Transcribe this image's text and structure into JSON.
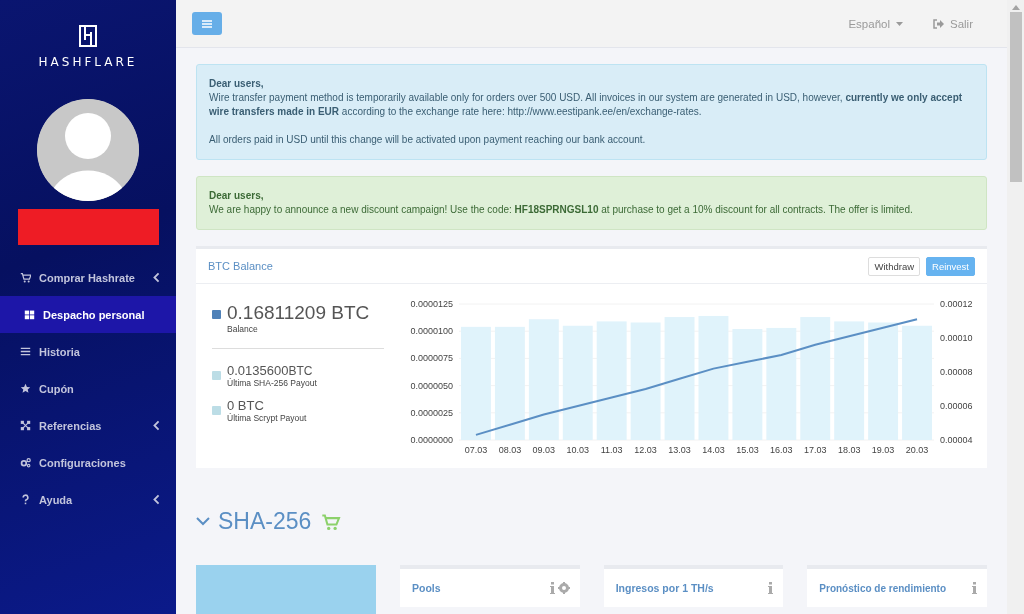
{
  "sidebar": {
    "logo_text": "HASHFLARE",
    "items": [
      {
        "kind": "cart",
        "label": "Comprar Hashrate",
        "has_submenu": true,
        "selected": false
      },
      {
        "kind": "grid",
        "label": "Despacho personal",
        "has_submenu": false,
        "selected": true
      },
      {
        "kind": "list",
        "label": "Historia",
        "has_submenu": false,
        "selected": false
      },
      {
        "kind": "star",
        "label": "Cupón",
        "has_submenu": false,
        "selected": false
      },
      {
        "kind": "network",
        "label": "Referencias",
        "has_submenu": true,
        "selected": false
      },
      {
        "kind": "gears",
        "label": "Configuraciones",
        "has_submenu": false,
        "selected": false
      },
      {
        "kind": "question",
        "label": "Ayuda",
        "has_submenu": true,
        "selected": false
      }
    ]
  },
  "topbar": {
    "language": "Español",
    "logout": "Salir"
  },
  "alerts": [
    {
      "kind": "info",
      "heading": "Dear users,",
      "text": "Wire transfer payment method is temporarily available only for orders over 500 USD. All invoices in our system are generated in USD, however, **currently we only accept wire transfers made in EUR** according to the exchange rate here:",
      "link": "http://www.eestipank.ee/en/exchange-rates",
      "text_after": ".",
      "note": "All orders paid in USD until this change will be activated upon payment reaching our bank account."
    },
    {
      "kind": "success",
      "heading": "Dear users,",
      "text": "We are happy to announce a new discount campaign! Use the code: **HF18SPRNGSL10** at purchase to get a 10% discount for all contracts. The offer is limited."
    }
  ],
  "balance_panel": {
    "title": "BTC Balance",
    "buttons": [
      {
        "label": "Withdraw",
        "kind": "default"
      },
      {
        "label": "Reinvest",
        "kind": "primary"
      }
    ],
    "stats": [
      {
        "value": "0.16811209 BTC",
        "label": "Balance",
        "color": "#4f81b8"
      },
      {
        "value": "0.0135600",
        "unit": "BTC",
        "label": "Última SHA-256 Payout",
        "color": "#bcdde6"
      },
      {
        "value": "0 BTC",
        "label": "Última Scrypt Payout",
        "color": "#bcdde6"
      }
    ],
    "chart_data": {
      "type": "bar",
      "categories": [
        "07.03",
        "08.03",
        "09.03",
        "10.03",
        "11.03",
        "12.03",
        "13.03",
        "14.03",
        "15.03",
        "16.03",
        "17.03",
        "18.03",
        "19.03",
        "20.03"
      ],
      "series": [
        {
          "color": "#e0f3fb",
          "values": [
            1.04e-05,
            1.04e-05,
            1.11e-05,
            1.05e-05,
            1.09e-05,
            1.08e-05,
            1.13e-05,
            1.14e-05,
            1.02e-05,
            1.03e-05,
            1.13e-05,
            1.09e-05,
            1.08e-05,
            1.05e-05
          ]
        },
        {
          "type": "line",
          "axis": "y2",
          "color": "#5b8fc4",
          "values": [
            4.3e-05,
            4.9e-05,
            5.5e-05,
            6e-05,
            6.5e-05,
            7e-05,
            7.6e-05,
            8.2e-05,
            8.6e-05,
            9e-05,
            9.6e-05,
            0.000101,
            0.000106,
            0.000111
          ]
        }
      ],
      "ylim": [
        0,
        1.25e-05
      ],
      "yticks": [
        {
          "value": 0,
          "label": "0.0000000"
        },
        {
          "value": 2.5e-06,
          "label": "0.0000025"
        },
        {
          "value": 5e-06,
          "label": "0.0000050"
        },
        {
          "value": 7.5e-06,
          "label": "0.0000075"
        },
        {
          "value": 1e-05,
          "label": "0.0000100"
        },
        {
          "value": 1.25e-05,
          "label": "0.0000125"
        }
      ],
      "grid": true,
      "y2lim": [
        4e-05,
        0.00012
      ],
      "y2ticks": [
        {
          "value": 4e-05,
          "label": "0.00004"
        },
        {
          "value": 6e-05,
          "label": "0.00006"
        },
        {
          "value": 8e-05,
          "label": "0.00008"
        },
        {
          "value": 0.0001,
          "label": "0.00010"
        },
        {
          "value": 0.00012,
          "label": "0.00012"
        }
      ]
    }
  },
  "section": {
    "title": "SHA-256",
    "cards": [
      {
        "title": "Pools",
        "info_icon": true,
        "settings_icon": true
      },
      {
        "title": "Ingresos por 1 TH/s",
        "info_icon": true,
        "settings_icon": false
      },
      {
        "title": "Pronóstico de rendimiento",
        "info_icon": true,
        "settings_icon": false
      }
    ]
  }
}
